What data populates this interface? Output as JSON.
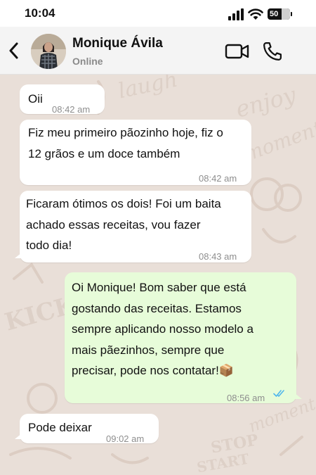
{
  "status_bar": {
    "time": "10:04",
    "battery": "50",
    "battery_level_percent": 50
  },
  "header": {
    "contact_name": "Monique Ávila",
    "contact_status": "Online"
  },
  "messages": [
    {
      "direction": "in",
      "text": "Oii",
      "time": "08:42 am"
    },
    {
      "direction": "in",
      "text": "Fiz meu primeiro pãozinho hoje, fiz o\n12 grãos e um doce também",
      "time": "08:42 am"
    },
    {
      "direction": "in",
      "text": "Ficaram ótimos os dois! Foi um baita\nachado essas receitas, vou fazer\ntodo dia!",
      "time": "08:43 am"
    },
    {
      "direction": "out",
      "text": "Oi Monique! Bom saber que está\ngostando das receitas. Estamos\nsempre aplicando nosso modelo a\nmais pãezinhos, sempre que\nprecisar, pode nos contatar!📦",
      "time": "08:56 am",
      "status": "read"
    },
    {
      "direction": "in",
      "text": "Pode deixar",
      "time": "09:02 am"
    }
  ],
  "wallpaper_words": [
    "laugh",
    "enjoy",
    "moment",
    "KICK",
    "moment",
    "STOP",
    "START"
  ],
  "colors": {
    "incoming": "#ffffff",
    "outgoing": "#e7fcd9",
    "read_ticks": "#4fb6ec",
    "wallpaper": "#e9dfd8"
  }
}
